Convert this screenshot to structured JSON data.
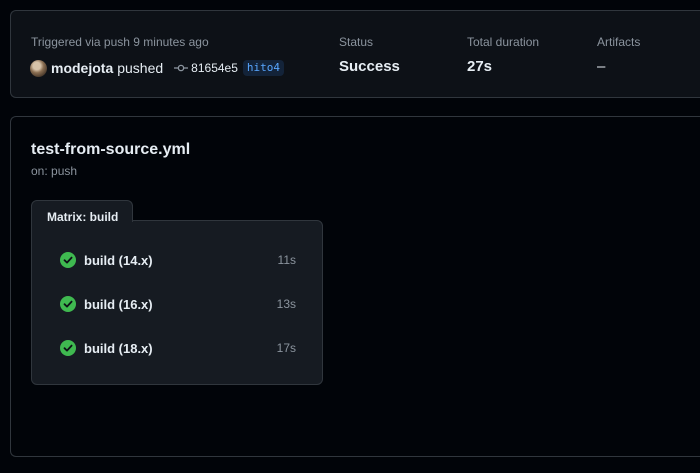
{
  "summary": {
    "trigger_text": "Triggered via push 9 minutes ago",
    "actor": "modejota",
    "action": "pushed",
    "commit_sha": "81654e5",
    "branch": "hito4",
    "status_label": "Status",
    "status_value": "Success",
    "duration_label": "Total duration",
    "duration_value": "27s",
    "artifacts_label": "Artifacts",
    "artifacts_value": "–"
  },
  "workflow": {
    "file": "test-from-source.yml",
    "trigger": "on: push",
    "matrix_label": "Matrix: build",
    "jobs": [
      {
        "name": "build (14.x)",
        "duration": "11s",
        "status": "success"
      },
      {
        "name": "build (16.x)",
        "duration": "13s",
        "status": "success"
      },
      {
        "name": "build (18.x)",
        "duration": "17s",
        "status": "success"
      }
    ]
  },
  "colors": {
    "success": "#3fb950",
    "branch_text": "#58a6ff",
    "background": "#010409",
    "panel": "#0d1117",
    "border": "#30363d"
  },
  "icons": [
    "avatar",
    "commit-icon",
    "check-circle-icon"
  ]
}
